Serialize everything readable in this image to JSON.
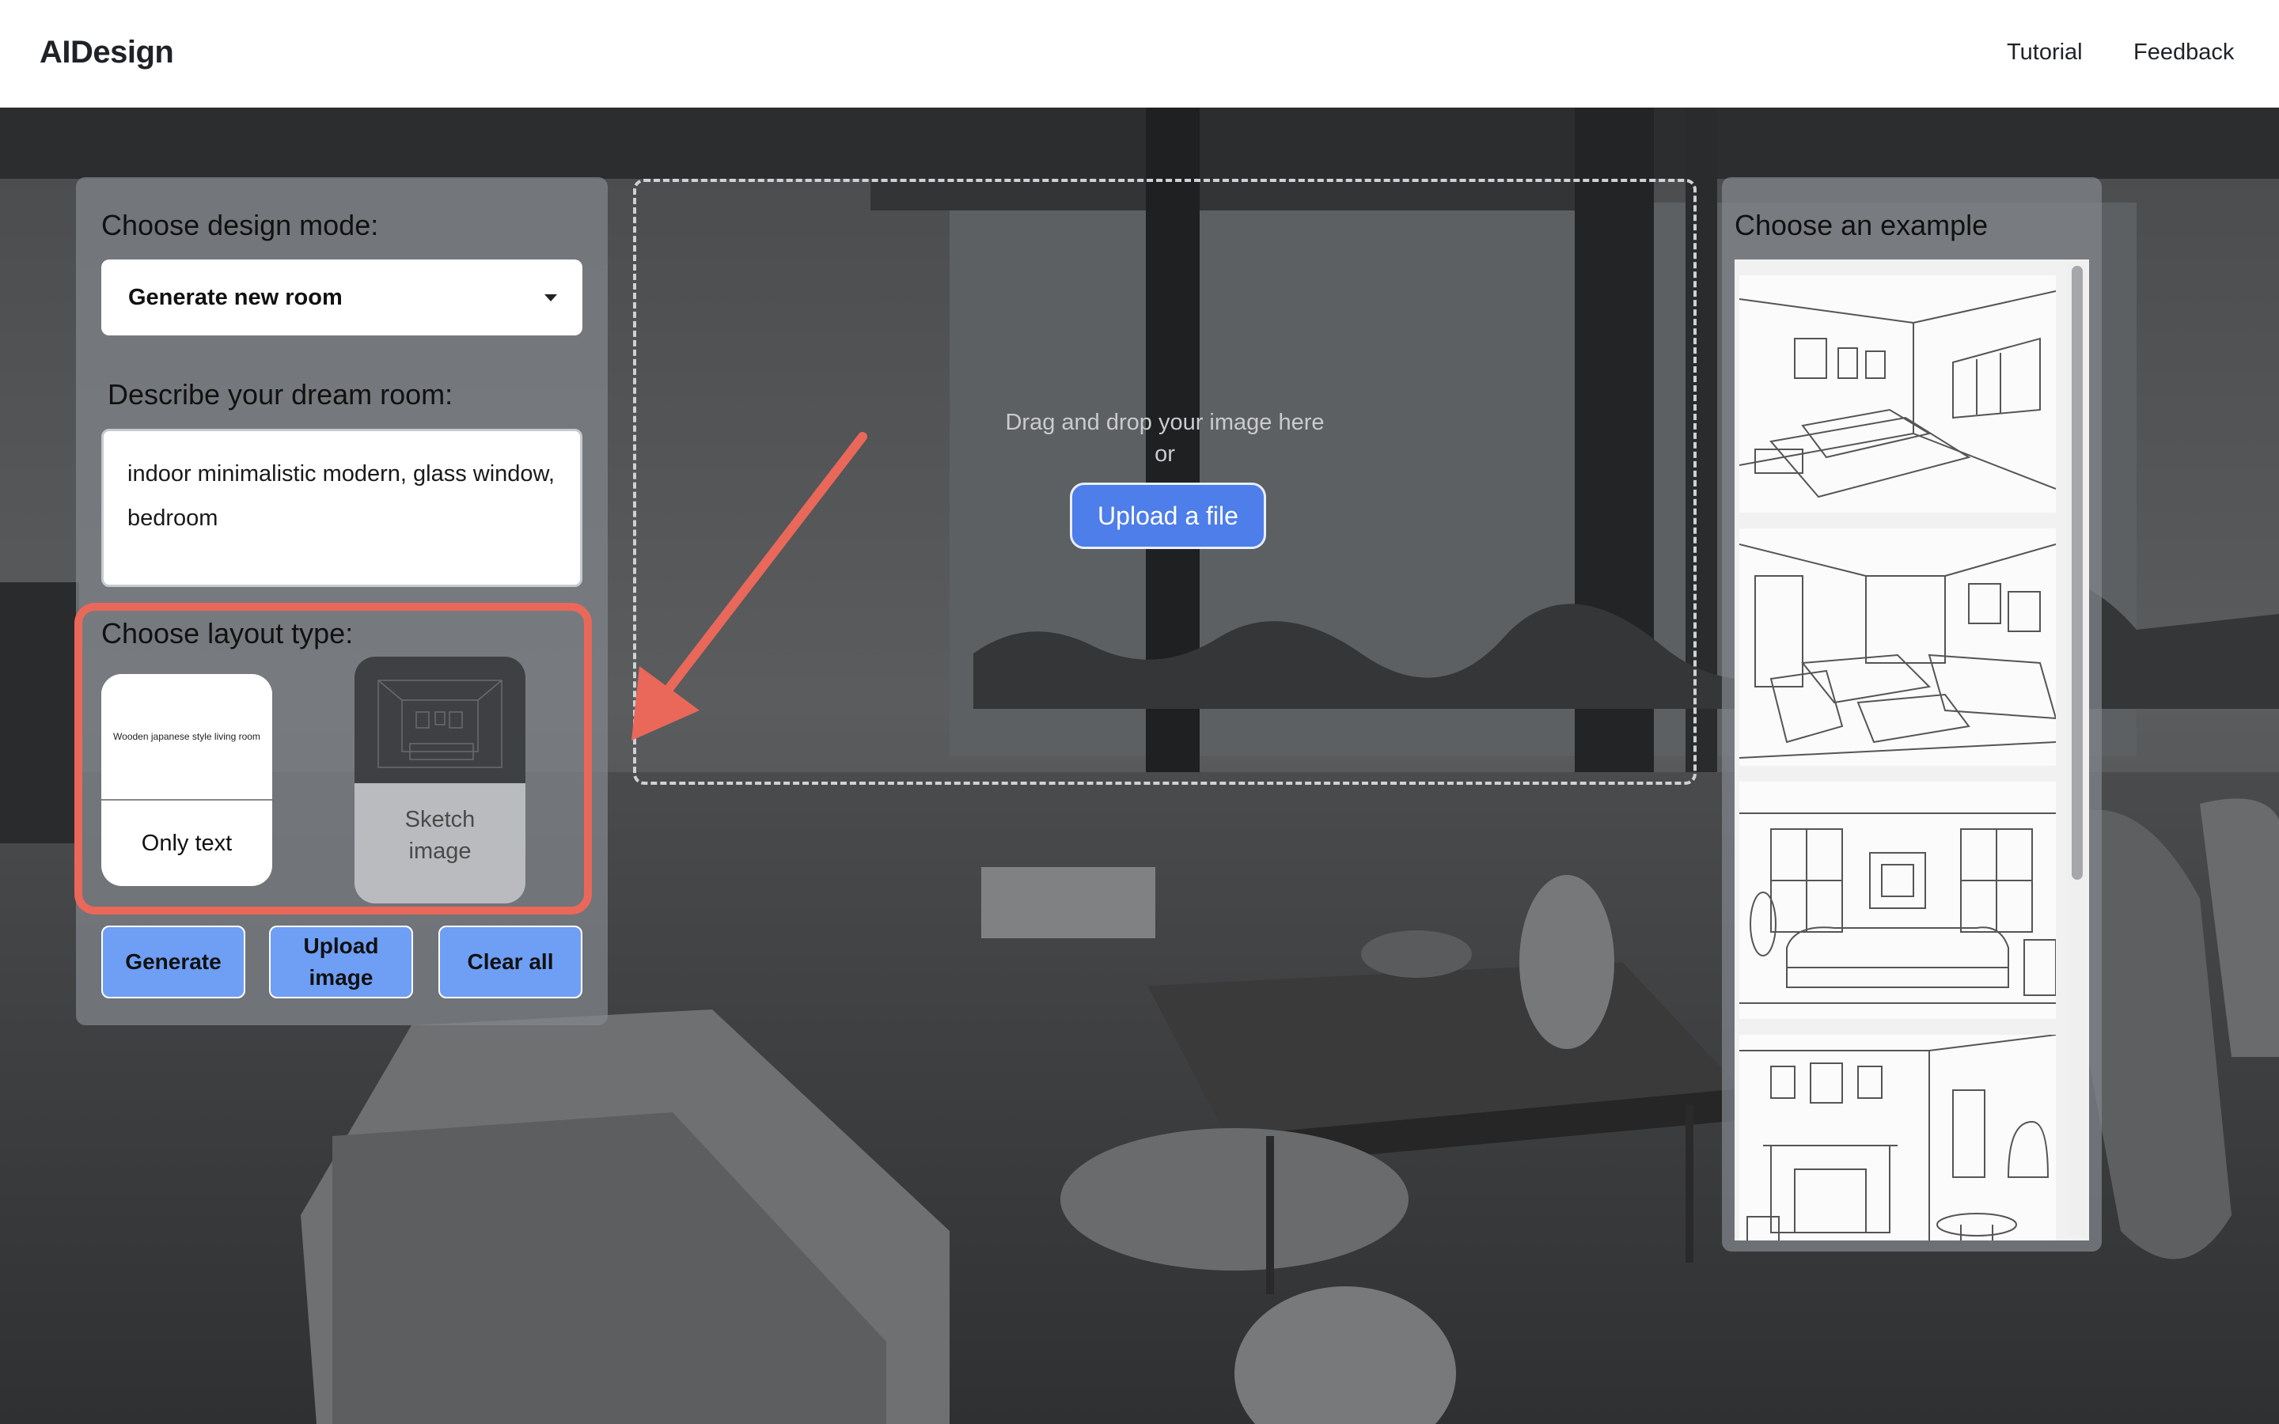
{
  "header": {
    "brand": "AIDesign",
    "nav": [
      "Tutorial",
      "Feedback"
    ]
  },
  "left_panel": {
    "mode_label": "Choose design mode:",
    "mode_value": "Generate new room",
    "describe_label": "Describe your dream room:",
    "describe_value": "indoor minimalistic modern, glass window, bedroom",
    "layout_label": "Choose layout type:",
    "layout_cards": [
      {
        "label": "Only text",
        "thumb_caption": "Wooden japanese style living room"
      },
      {
        "label_line1": "Sketch",
        "label_line2": "image"
      }
    ],
    "buttons": {
      "generate": "Generate",
      "upload_line1": "Upload",
      "upload_line2": "image",
      "clear": "Clear all"
    }
  },
  "dropzone": {
    "line1": "Drag and drop your image here",
    "line2": "or",
    "upload_button": "Upload a file"
  },
  "right_panel": {
    "title": "Choose an example",
    "examples": [
      "bedroom-sketch",
      "living-room-sketch",
      "sofa-room-sketch",
      "fireplace-room-sketch"
    ]
  },
  "colors": {
    "accent_button": "#6e9ff5",
    "upload_button": "#4d7ee9",
    "highlight": "#e9685a"
  }
}
